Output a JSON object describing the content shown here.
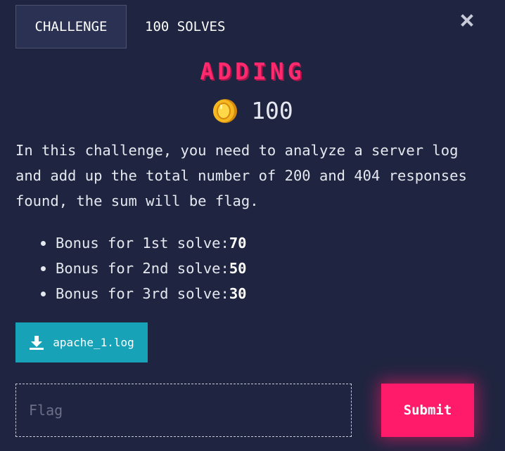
{
  "tabs": {
    "challenge_label": "CHALLENGE",
    "solves_label": "100 SOLVES"
  },
  "challenge": {
    "title": "ADDING",
    "points": "100",
    "description": "In this challenge, you need to analyze a server log and add up the total number of 200 and 404 responses found, the sum will be flag.",
    "bonuses": [
      {
        "label": "Bonus for 1st solve: ",
        "value": "70"
      },
      {
        "label": "Bonus for 2nd solve: ",
        "value": "50"
      },
      {
        "label": "Bonus for 3rd solve: ",
        "value": "30"
      }
    ]
  },
  "download": {
    "filename": "apache_1.log",
    "icon": "download-icon"
  },
  "flag_form": {
    "placeholder": "Flag",
    "value": "",
    "submit_label": "Submit"
  },
  "icons": {
    "close": "close-icon",
    "coin": "coin-icon"
  },
  "colors": {
    "background": "#1f2540",
    "accent": "#ff1a6a",
    "title": "#ff2a6d",
    "download_button": "#17a2b8",
    "coin": "#f5b820"
  }
}
